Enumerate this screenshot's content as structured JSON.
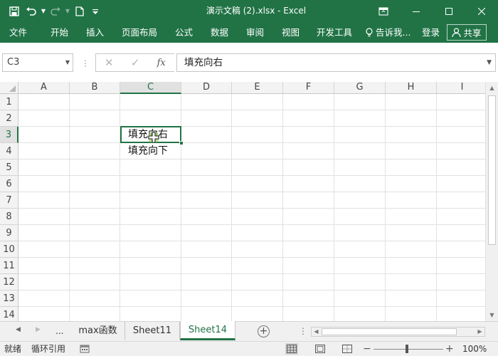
{
  "window": {
    "title": "演示文稿 (2).xlsx - Excel"
  },
  "ribbon": {
    "tabs": [
      {
        "label": "文件"
      },
      {
        "label": "开始"
      },
      {
        "label": "插入"
      },
      {
        "label": "页面布局"
      },
      {
        "label": "公式"
      },
      {
        "label": "数据"
      },
      {
        "label": "审阅"
      },
      {
        "label": "视图"
      },
      {
        "label": "开发工具"
      }
    ],
    "tell_me": "告诉我...",
    "login": "登录",
    "share": "共享"
  },
  "formula_bar": {
    "name_box": "C3",
    "content": "填充向右"
  },
  "grid": {
    "columns": [
      "A",
      "B",
      "C",
      "D",
      "E",
      "F",
      "G",
      "H",
      "I"
    ],
    "rows": [
      "1",
      "2",
      "3",
      "4",
      "5",
      "6",
      "7",
      "8",
      "9",
      "10",
      "11",
      "12",
      "13",
      "14"
    ],
    "selected_column": "C",
    "selected_row": "3",
    "cells": {
      "C3": "填充向右",
      "C4": "填充向下"
    }
  },
  "sheets": {
    "ellipsis": "...",
    "tabs": [
      {
        "label": "max函数"
      },
      {
        "label": "Sheet11"
      },
      {
        "label": "Sheet14"
      }
    ],
    "active": "Sheet14"
  },
  "status": {
    "ready": "就绪",
    "circular": "循环引用",
    "zoom": "100%"
  },
  "colors": {
    "accent": "#217346",
    "chrome_bg": "#f0f0f0",
    "gridline": "#e1e1e1"
  }
}
